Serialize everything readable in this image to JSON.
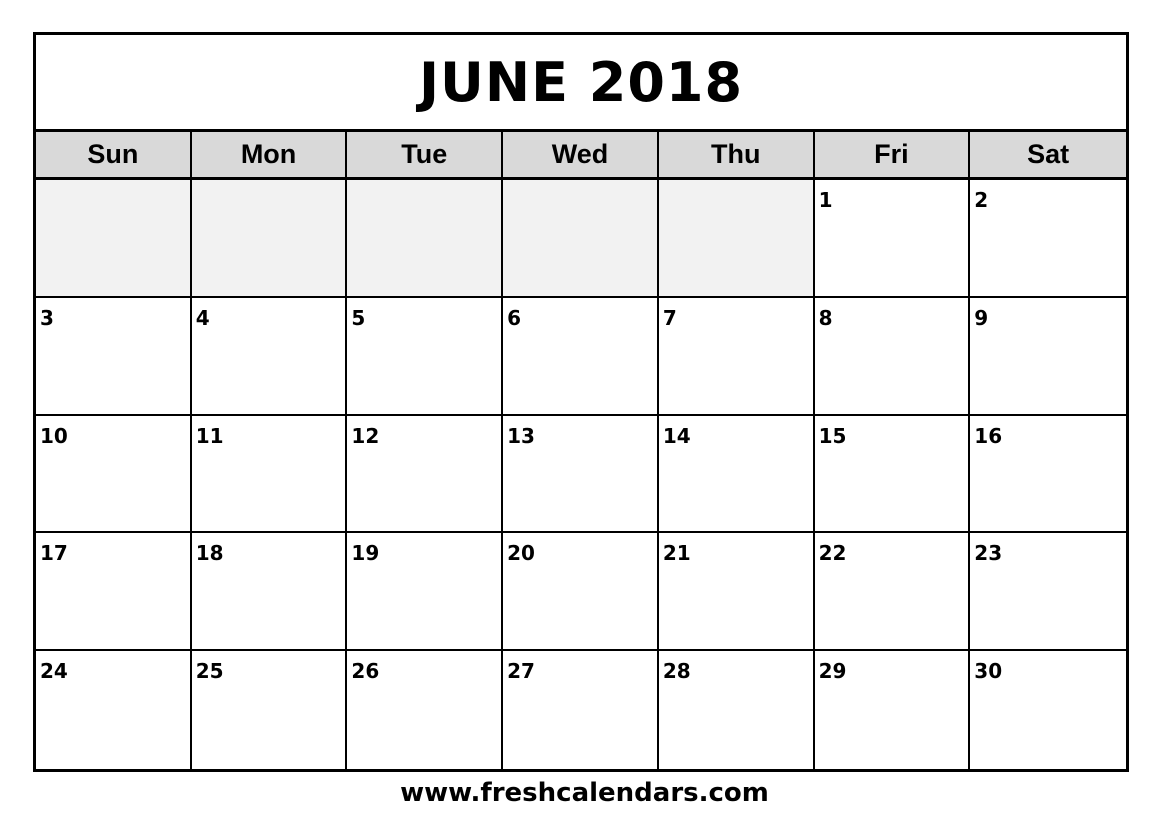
{
  "calendar": {
    "title": "JUNE 2018",
    "weekdays": [
      "Sun",
      "Mon",
      "Tue",
      "Wed",
      "Thu",
      "Fri",
      "Sat"
    ],
    "weeks": [
      [
        "",
        "",
        "",
        "",
        "",
        "1",
        "2"
      ],
      [
        "3",
        "4",
        "5",
        "6",
        "7",
        "8",
        "9"
      ],
      [
        "10",
        "11",
        "12",
        "13",
        "14",
        "15",
        "16"
      ],
      [
        "17",
        "18",
        "19",
        "20",
        "21",
        "22",
        "23"
      ],
      [
        "24",
        "25",
        "26",
        "27",
        "28",
        "29",
        "30"
      ]
    ]
  },
  "colors": {
    "header_bg": "#d9d9d9",
    "empty_cell_bg": "#f2f2f2",
    "border": "#000000"
  },
  "footer": {
    "website": "www.freshcalendars.com"
  }
}
